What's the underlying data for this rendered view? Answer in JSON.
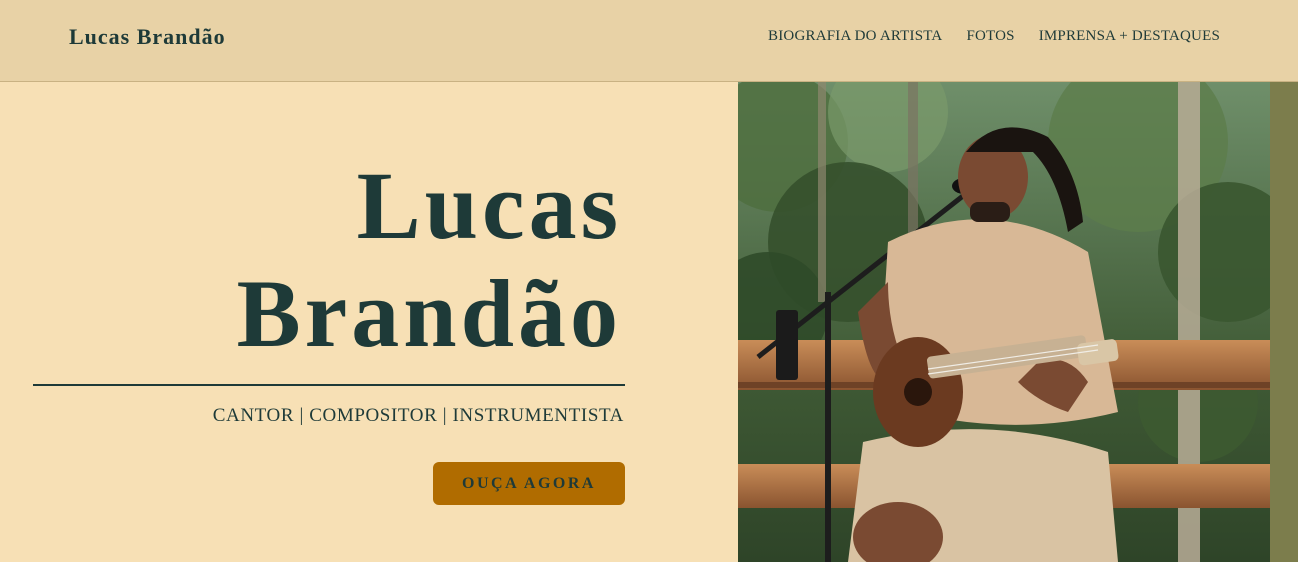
{
  "header": {
    "brand": "Lucas Brandão",
    "nav": [
      {
        "label": "BIOGRAFIA DO ARTISTA"
      },
      {
        "label": "FOTOS"
      },
      {
        "label": "IMPRENSA + DESTAQUES"
      }
    ]
  },
  "hero": {
    "title_line1": "Lucas",
    "title_line2": "Brandão",
    "subtitle": "CANTOR | COMPOSITOR | INSTRUMENTISTA",
    "cta_label": "OUÇA AGORA",
    "photo": "performer-with-guitar-photo"
  },
  "colors": {
    "background": "#f7e0b5",
    "header": "#e8d2a6",
    "text": "#1e3a38",
    "cta": "#b06c00",
    "side_strip": "#7c7d4c"
  }
}
